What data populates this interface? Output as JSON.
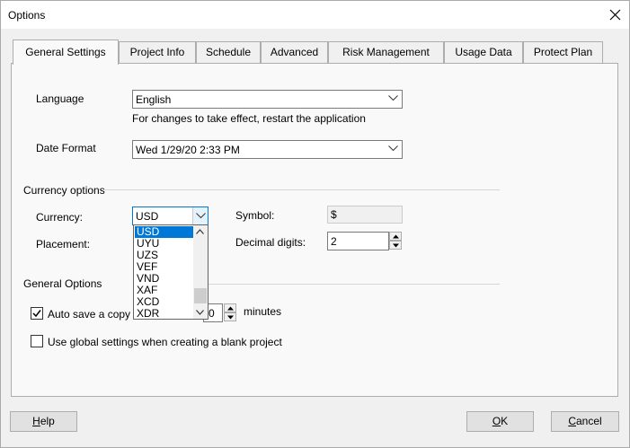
{
  "window": {
    "title": "Options"
  },
  "tabs": [
    {
      "label": "General Settings"
    },
    {
      "label": "Project Info"
    },
    {
      "label": "Schedule"
    },
    {
      "label": "Advanced"
    },
    {
      "label": "Risk Management"
    },
    {
      "label": "Usage Data"
    },
    {
      "label": "Protect Plan"
    }
  ],
  "general": {
    "language_label": "Language",
    "language_value": "English",
    "language_hint": "For changes to take effect, restart the application",
    "date_format_label": "Date Format",
    "date_format_value": "Wed 1/29/20 2:33 PM"
  },
  "currency": {
    "section_title": "Currency options",
    "currency_label": "Currency:",
    "currency_value": "USD",
    "placement_label": "Placement:",
    "symbol_label": "Symbol:",
    "symbol_value": "$",
    "decimal_label": "Decimal digits:",
    "decimal_value": "2",
    "dropdown_options": [
      "USD",
      "UYU",
      "UZS",
      "VEF",
      "VND",
      "XAF",
      "XCD",
      "XDR"
    ],
    "selected_option": "USD"
  },
  "general_options": {
    "section_title": "General Options",
    "autosave_label": "Auto save a copy ev",
    "autosave_checked": true,
    "autosave_value": "0",
    "minutes_label": "minutes",
    "global_settings_label": "Use global settings when creating a blank project",
    "global_settings_checked": false
  },
  "buttons": {
    "help_prefix": "",
    "help_key": "H",
    "help_rest": "elp",
    "ok_key": "O",
    "ok_rest": "K",
    "cancel_key": "C",
    "cancel_rest": "ancel"
  },
  "colors": {
    "selection": "#0078d7",
    "panel": "#f9f9f9",
    "window": "#f0f0f0"
  }
}
